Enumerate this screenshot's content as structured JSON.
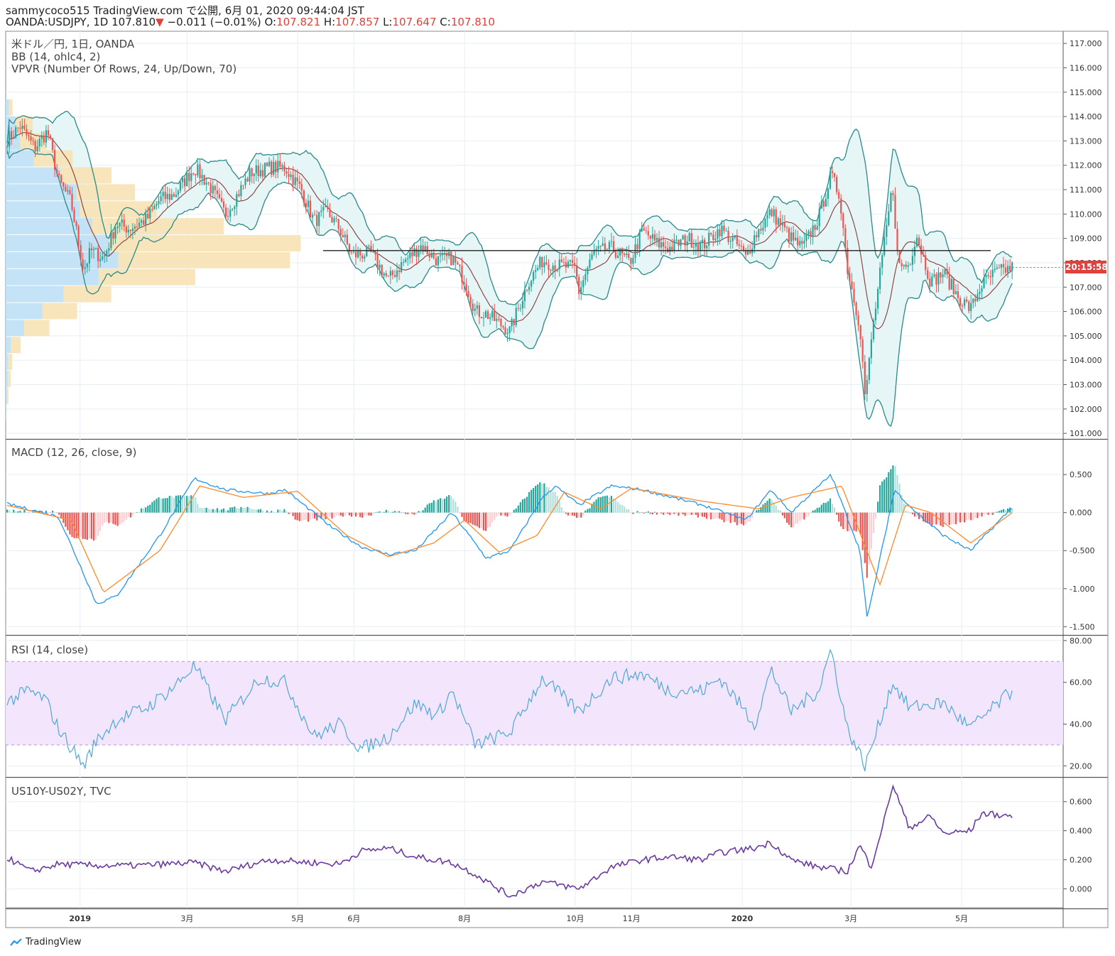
{
  "header": {
    "line1": "sammycoco515 TradingView.com で公開, 6月 01, 2020 09:44:04 JST",
    "symbol": "OANDA:USDJPY, 1D",
    "last": "107.810",
    "change": "−0.011 (−0.01%)",
    "o_label": "O:",
    "o": "107.821",
    "h_label": "H:",
    "h": "107.857",
    "l_label": "L:",
    "l": "107.647",
    "c_label": "C:",
    "c": "107.810",
    "down_arrow": "▼"
  },
  "panes": {
    "price": {
      "title": "米ドル／円, 1日, OANDA",
      "bb": "BB (14, ohlc4, 2)",
      "vpvr": "VPVR (Number Of Rows, 24, Up/Down, 70)"
    },
    "macd": {
      "title": "MACD (12, 26, close, 9)"
    },
    "rsi": {
      "title": "RSI (14, close)"
    },
    "spread": {
      "title": "US10Y-US02Y, TVC"
    }
  },
  "price_tag": "20:15:58",
  "footer": {
    "brand": "TradingView"
  },
  "colors": {
    "up": "#26a69a",
    "down": "#ef5350",
    "bb": "#2a8a8a",
    "bb_fill": "#e6f5f5",
    "basis": "#8b3a3a",
    "macd": "#2196f3",
    "signal": "#ff8a2a",
    "rsi": "#4fa8d8",
    "rsi_band": "#f3e5fb",
    "spread": "#6a3aa0",
    "vp_up": "#bfe0f5",
    "vp_down": "#f7e2b5"
  },
  "chart_data": [
    {
      "type": "candlestick",
      "title": "米ドル／円, 1日, OANDA",
      "ylim": [
        100.8,
        117.5
      ],
      "yticks": [
        "117.000",
        "116.000",
        "115.000",
        "114.000",
        "113.000",
        "112.000",
        "111.000",
        "110.000",
        "109.000",
        "108.000",
        "107.000",
        "106.000",
        "105.000",
        "104.000",
        "103.000",
        "102.000",
        "101.000"
      ],
      "xticks": [
        "2019",
        "3月",
        "5月",
        "6月",
        "8月",
        "10月",
        "11月",
        "2020",
        "3月",
        "5月"
      ],
      "close_path": [
        [
          "2018-11-21",
          113.0
        ],
        [
          "2018-11-29",
          113.6
        ],
        [
          "2018-12-07",
          112.7
        ],
        [
          "2018-12-14",
          113.4
        ],
        [
          "2018-12-20",
          111.4
        ],
        [
          "2018-12-27",
          110.5
        ],
        [
          "2019-01-03",
          107.7
        ],
        [
          "2019-01-07",
          108.5
        ],
        [
          "2019-01-14",
          108.2
        ],
        [
          "2019-01-21",
          109.6
        ],
        [
          "2019-01-28",
          109.4
        ],
        [
          "2019-02-07",
          109.8
        ],
        [
          "2019-02-14",
          110.6
        ],
        [
          "2019-02-22",
          110.8
        ],
        [
          "2019-03-05",
          111.9
        ],
        [
          "2019-03-13",
          111.2
        ],
        [
          "2019-03-22",
          110.0
        ],
        [
          "2019-03-28",
          110.7
        ],
        [
          "2019-04-05",
          111.7
        ],
        [
          "2019-04-15",
          111.9
        ],
        [
          "2019-04-24",
          111.9
        ],
        [
          "2019-05-03",
          111.0
        ],
        [
          "2019-05-10",
          109.7
        ],
        [
          "2019-05-17",
          110.1
        ],
        [
          "2019-05-24",
          109.4
        ],
        [
          "2019-05-31",
          108.3
        ],
        [
          "2019-06-10",
          108.4
        ],
        [
          "2019-06-20",
          107.3
        ],
        [
          "2019-06-28",
          108.0
        ],
        [
          "2019-07-08",
          108.7
        ],
        [
          "2019-07-17",
          108.1
        ],
        [
          "2019-07-25",
          108.2
        ],
        [
          "2019-08-01",
          107.3
        ],
        [
          "2019-08-07",
          106.0
        ],
        [
          "2019-08-13",
          105.9
        ],
        [
          "2019-08-26",
          105.2
        ],
        [
          "2019-09-05",
          107.2
        ],
        [
          "2019-09-13",
          108.1
        ],
        [
          "2019-09-20",
          107.9
        ],
        [
          "2019-10-01",
          107.8
        ],
        [
          "2019-10-03",
          106.8
        ],
        [
          "2019-10-11",
          108.4
        ],
        [
          "2019-10-21",
          108.6
        ],
        [
          "2019-10-31",
          108.0
        ],
        [
          "2019-11-07",
          109.3
        ],
        [
          "2019-11-15",
          108.8
        ],
        [
          "2019-11-22",
          108.6
        ],
        [
          "2019-12-02",
          109.0
        ],
        [
          "2019-12-10",
          108.7
        ],
        [
          "2019-12-20",
          109.4
        ],
        [
          "2019-12-31",
          108.6
        ],
        [
          "2020-01-03",
          108.2
        ],
        [
          "2020-01-08",
          109.1
        ],
        [
          "2020-01-17",
          110.1
        ],
        [
          "2020-01-28",
          109.0
        ],
        [
          "2020-02-03",
          108.6
        ],
        [
          "2020-02-12",
          109.8
        ],
        [
          "2020-02-19",
          111.6
        ],
        [
          "2020-02-24",
          110.7
        ],
        [
          "2020-02-28",
          107.8
        ],
        [
          "2020-03-06",
          105.4
        ],
        [
          "2020-03-09",
          102.3
        ],
        [
          "2020-03-12",
          104.7
        ],
        [
          "2020-03-17",
          107.5
        ],
        [
          "2020-03-24",
          111.2
        ],
        [
          "2020-03-27",
          107.9
        ],
        [
          "2020-04-02",
          107.9
        ],
        [
          "2020-04-06",
          109.2
        ],
        [
          "2020-04-14",
          107.2
        ],
        [
          "2020-04-21",
          107.6
        ],
        [
          "2020-04-29",
          106.6
        ],
        [
          "2020-05-06",
          106.1
        ],
        [
          "2020-05-12",
          107.1
        ],
        [
          "2020-05-20",
          107.6
        ],
        [
          "2020-05-29",
          107.8
        ]
      ],
      "horizontal_line": 108.5,
      "last_price": 107.81
    },
    {
      "type": "line",
      "title": "MACD (12, 26, close, 9)",
      "ylim": [
        -1.6,
        0.95
      ],
      "yticks": [
        "0.500",
        "0.000",
        "-0.500",
        "-1.000",
        "-1.500"
      ],
      "series": [
        {
          "role": "macd",
          "points": [
            [
              "2018-11-21",
              0.12
            ],
            [
              "2018-12-20",
              -0.05
            ],
            [
              "2019-01-03",
              -0.8
            ],
            [
              "2019-01-10",
              -1.2
            ],
            [
              "2019-01-21",
              -1.1
            ],
            [
              "2019-02-14",
              -0.3
            ],
            [
              "2019-03-05",
              0.45
            ],
            [
              "2019-03-22",
              0.3
            ],
            [
              "2019-04-15",
              0.25
            ],
            [
              "2019-04-24",
              0.3
            ],
            [
              "2019-05-20",
              -0.2
            ],
            [
              "2019-06-05",
              -0.45
            ],
            [
              "2019-06-20",
              -0.55
            ],
            [
              "2019-07-05",
              -0.5
            ],
            [
              "2019-07-25",
              0.0
            ],
            [
              "2019-08-13",
              -0.6
            ],
            [
              "2019-08-26",
              -0.5
            ],
            [
              "2019-09-13",
              0.2
            ],
            [
              "2019-09-20",
              0.35
            ],
            [
              "2019-10-03",
              0.1
            ],
            [
              "2019-10-21",
              0.35
            ],
            [
              "2019-11-07",
              0.3
            ],
            [
              "2019-12-10",
              0.1
            ],
            [
              "2020-01-03",
              -0.1
            ],
            [
              "2020-01-17",
              0.3
            ],
            [
              "2020-01-28",
              0.0
            ],
            [
              "2020-02-19",
              0.5
            ],
            [
              "2020-03-06",
              -0.5
            ],
            [
              "2020-03-10",
              -1.4
            ],
            [
              "2020-03-25",
              0.3
            ],
            [
              "2020-04-06",
              0.0
            ],
            [
              "2020-04-21",
              -0.3
            ],
            [
              "2020-05-06",
              -0.5
            ],
            [
              "2020-05-29",
              0.07
            ]
          ]
        },
        {
          "role": "signal",
          "points": [
            [
              "2018-11-21",
              0.1
            ],
            [
              "2018-12-27",
              -0.1
            ],
            [
              "2019-01-14",
              -1.05
            ],
            [
              "2019-02-14",
              -0.5
            ],
            [
              "2019-03-08",
              0.35
            ],
            [
              "2019-04-01",
              0.2
            ],
            [
              "2019-05-01",
              0.28
            ],
            [
              "2019-05-28",
              -0.3
            ],
            [
              "2019-06-20",
              -0.58
            ],
            [
              "2019-07-15",
              -0.4
            ],
            [
              "2019-08-01",
              -0.1
            ],
            [
              "2019-08-20",
              -0.52
            ],
            [
              "2019-09-10",
              -0.3
            ],
            [
              "2019-09-25",
              0.27
            ],
            [
              "2019-10-15",
              0.05
            ],
            [
              "2019-11-01",
              0.32
            ],
            [
              "2019-12-10",
              0.15
            ],
            [
              "2020-01-10",
              0.05
            ],
            [
              "2020-01-28",
              0.2
            ],
            [
              "2020-02-25",
              0.35
            ],
            [
              "2020-03-17",
              -0.95
            ],
            [
              "2020-03-31",
              0.1
            ],
            [
              "2020-04-14",
              0.0
            ],
            [
              "2020-05-06",
              -0.4
            ],
            [
              "2020-05-29",
              0.0
            ]
          ]
        }
      ]
    },
    {
      "type": "line",
      "title": "RSI (14, close)",
      "ylim": [
        15,
        82
      ],
      "yticks": [
        "80.00",
        "60.00",
        "40.00",
        "20.00"
      ],
      "bands": [
        30,
        70
      ],
      "points": [
        [
          "2018-11-21",
          50
        ],
        [
          "2018-12-03",
          56
        ],
        [
          "2018-12-13",
          52
        ],
        [
          "2018-12-20",
          38
        ],
        [
          "2019-01-03",
          20
        ],
        [
          "2019-01-10",
          32
        ],
        [
          "2019-01-21",
          42
        ],
        [
          "2019-02-07",
          48
        ],
        [
          "2019-02-22",
          58
        ],
        [
          "2019-03-05",
          68
        ],
        [
          "2019-03-22",
          42
        ],
        [
          "2019-04-10",
          62
        ],
        [
          "2019-04-24",
          60
        ],
        [
          "2019-05-10",
          34
        ],
        [
          "2019-05-24",
          40
        ],
        [
          "2019-06-05",
          28
        ],
        [
          "2019-06-20",
          34
        ],
        [
          "2019-07-05",
          50
        ],
        [
          "2019-07-17",
          44
        ],
        [
          "2019-07-25",
          56
        ],
        [
          "2019-08-07",
          30
        ],
        [
          "2019-08-26",
          36
        ],
        [
          "2019-09-13",
          62
        ],
        [
          "2019-10-03",
          46
        ],
        [
          "2019-10-21",
          62
        ],
        [
          "2019-11-07",
          64
        ],
        [
          "2019-11-22",
          56
        ],
        [
          "2019-12-10",
          56
        ],
        [
          "2019-12-20",
          62
        ],
        [
          "2020-01-08",
          40
        ],
        [
          "2020-01-17",
          66
        ],
        [
          "2020-01-28",
          46
        ],
        [
          "2020-02-12",
          56
        ],
        [
          "2020-02-19",
          76
        ],
        [
          "2020-02-28",
          38
        ],
        [
          "2020-03-09",
          20
        ],
        [
          "2020-03-24",
          60
        ],
        [
          "2020-04-02",
          48
        ],
        [
          "2020-04-21",
          50
        ],
        [
          "2020-05-06",
          38
        ],
        [
          "2020-05-29",
          56
        ]
      ]
    },
    {
      "type": "line",
      "title": "US10Y-US02Y, TVC",
      "ylim": [
        -0.13,
        0.76
      ],
      "yticks": [
        "0.600",
        "0.400",
        "0.200",
        "0.000"
      ],
      "points": [
        [
          "2018-11-21",
          0.22
        ],
        [
          "2018-12-05",
          0.12
        ],
        [
          "2018-12-20",
          0.17
        ],
        [
          "2019-01-10",
          0.16
        ],
        [
          "2019-02-01",
          0.16
        ],
        [
          "2019-03-05",
          0.18
        ],
        [
          "2019-03-22",
          0.12
        ],
        [
          "2019-04-15",
          0.2
        ],
        [
          "2019-05-10",
          0.18
        ],
        [
          "2019-05-24",
          0.17
        ],
        [
          "2019-06-05",
          0.26
        ],
        [
          "2019-06-20",
          0.28
        ],
        [
          "2019-07-05",
          0.22
        ],
        [
          "2019-07-25",
          0.18
        ],
        [
          "2019-08-07",
          0.1
        ],
        [
          "2019-08-26",
          -0.05
        ],
        [
          "2019-09-13",
          0.05
        ],
        [
          "2019-10-03",
          0.0
        ],
        [
          "2019-10-21",
          0.15
        ],
        [
          "2019-11-07",
          0.2
        ],
        [
          "2019-11-22",
          0.22
        ],
        [
          "2019-12-10",
          0.2
        ],
        [
          "2019-12-20",
          0.25
        ],
        [
          "2020-01-08",
          0.28
        ],
        [
          "2020-01-17",
          0.32
        ],
        [
          "2020-01-28",
          0.2
        ],
        [
          "2020-02-12",
          0.15
        ],
        [
          "2020-02-28",
          0.12
        ],
        [
          "2020-03-06",
          0.3
        ],
        [
          "2020-03-12",
          0.15
        ],
        [
          "2020-03-20",
          0.5
        ],
        [
          "2020-03-24",
          0.72
        ],
        [
          "2020-04-02",
          0.42
        ],
        [
          "2020-04-14",
          0.5
        ],
        [
          "2020-04-21",
          0.38
        ],
        [
          "2020-05-06",
          0.4
        ],
        [
          "2020-05-12",
          0.52
        ],
        [
          "2020-05-29",
          0.5
        ]
      ]
    }
  ]
}
